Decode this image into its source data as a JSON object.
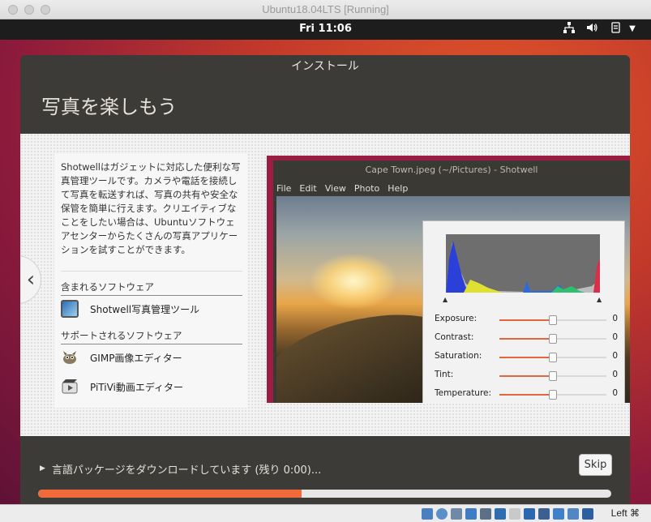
{
  "host_window": {
    "title": "Ubuntu18.04LTS [Running]"
  },
  "ubuntu_topbar": {
    "clock": "Fri 11:06",
    "tray_icons": [
      "network-icon",
      "volume-icon",
      "power-icon",
      "chevron-down-icon"
    ]
  },
  "installer": {
    "window_title": "インストール",
    "heading": "写真を楽しもう",
    "description": "Shotwellはガジェットに対応した便利な写真管理ツールです。カメラや電話を接続して写真を転送すれば、写真の共有や安全な保管を簡単に行えます。クリエイティブなことをしたい場合は、Ubuntuソフトウェアセンターからたくさんの写真アプリケーションを試すことができます。",
    "included_label": "含まれるソフトウェア",
    "included_apps": [
      {
        "name": "Shotwell写真管理ツール",
        "icon": "shotwell-icon"
      }
    ],
    "supported_label": "サポートされるソフトウェア",
    "supported_apps": [
      {
        "name": "GIMP画像エディター",
        "icon": "gimp-icon"
      },
      {
        "name": "PiTiVi動画エディター",
        "icon": "pitivi-icon"
      }
    ],
    "nav": {
      "prev": "‹",
      "next": "›"
    },
    "screenshot": {
      "title": "Cape Town.jpeg (~/Pictures) - Shotwell",
      "menu": [
        "File",
        "Edit",
        "View",
        "Photo",
        "Help"
      ],
      "adjustments": [
        {
          "label": "Exposure:",
          "value": "0",
          "level": 0.5
        },
        {
          "label": "Contrast:",
          "value": "0",
          "level": 0.5
        },
        {
          "label": "Saturation:",
          "value": "0",
          "level": 0.5
        },
        {
          "label": "Tint:",
          "value": "0",
          "level": 0.5
        },
        {
          "label": "Temperature:",
          "value": "0",
          "level": 0.5
        }
      ]
    },
    "status_text": "言語パッケージをダウンロードしています (残り 0:00)...",
    "skip_label": "Skip",
    "progress_fraction": 0.46
  },
  "vbox_statusbar": {
    "host_key": "Left ⌘"
  },
  "colors": {
    "accent": "#f06a3a",
    "window_bg": "#3c3b37",
    "topbar": "#1d1d1d"
  }
}
